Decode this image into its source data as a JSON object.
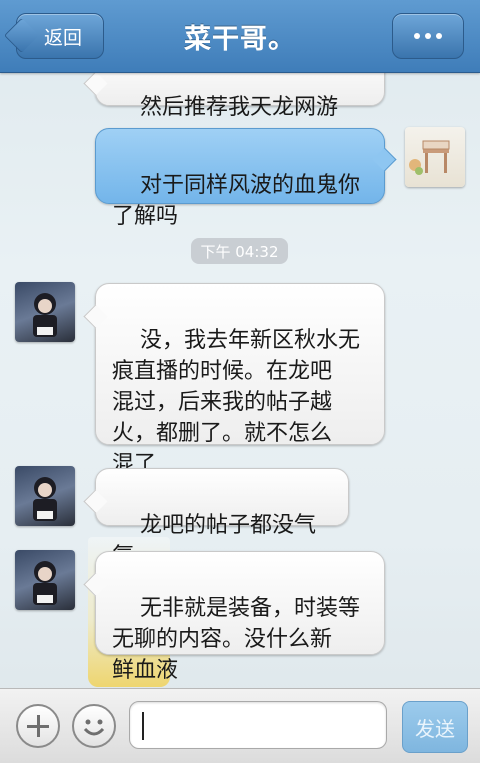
{
  "header": {
    "back_label": "返回",
    "title": "菜干哥。"
  },
  "messages": [
    {
      "sender": "self",
      "text": "然后推荐我天龙网游"
    },
    {
      "sender": "self",
      "text": "对于同样风波的血鬼你\n了解吗"
    },
    {
      "sender": "contact",
      "text": "没，我去年新区秋水无\n痕直播的时候。在龙吧\n混过，后来我的帖子越\n火，都删了。就不怎么\n混了"
    },
    {
      "sender": "contact",
      "text": "龙吧的帖子都没气氛"
    },
    {
      "sender": "contact",
      "text": "无非就是装备，时装等\n无聊的内容。没什么新\n鲜血液"
    }
  ],
  "timestamp": "下午 04:32",
  "input": {
    "value": "",
    "send_label": "发送"
  },
  "colors": {
    "header": "#4a86c2",
    "outgoing_bubble": "#8ec6f1",
    "incoming_bubble": "#f5f5f5"
  }
}
